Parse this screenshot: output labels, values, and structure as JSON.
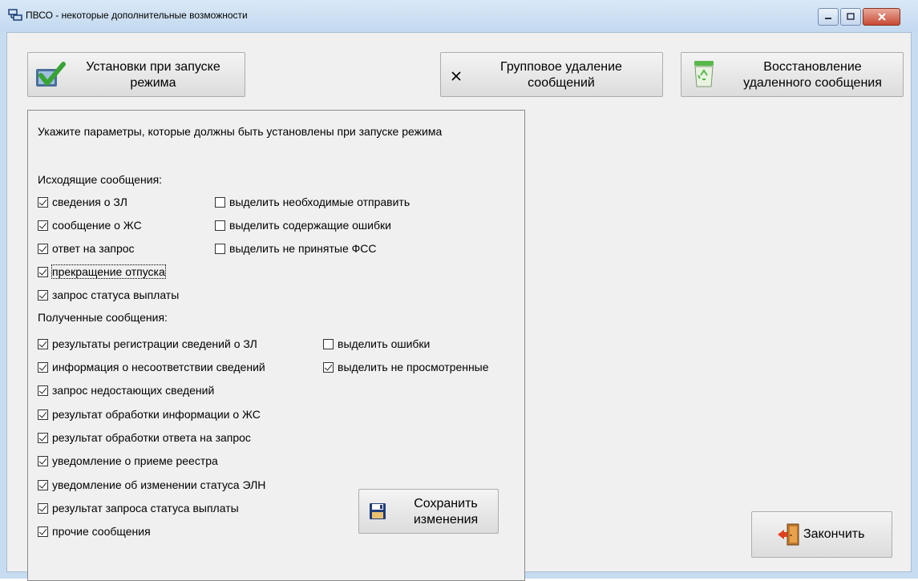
{
  "window": {
    "title": "ПВСО - некоторые дополнительные возможности"
  },
  "toolbar": {
    "startup_button": "Установки при запуске режима",
    "startup_line1": "Установки при запуске",
    "startup_line2": "режима",
    "group_delete_line1": "Групповое удаление",
    "group_delete_line2": "сообщений",
    "restore_line1": "Восстановление",
    "restore_line2": "удаленного сообщения"
  },
  "panel": {
    "instruction": "Укажите параметры, которые должны быть установлены при запуске режима",
    "outgoing_header": "Исходящие сообщения:",
    "outgoing_items": [
      {
        "label": "сведения о ЗЛ",
        "checked": true
      },
      {
        "label": "сообщение о ЖС",
        "checked": true
      },
      {
        "label": "ответ на запрос",
        "checked": true
      },
      {
        "label": "прекращение отпуска",
        "checked": true
      },
      {
        "label": "запрос статуса выплаты",
        "checked": true
      }
    ],
    "outgoing_options": [
      {
        "label": "выделить необходимые отправить",
        "checked": false
      },
      {
        "label": "выделить содержащие ошибки",
        "checked": false
      },
      {
        "label": "выделить не принятые ФСС",
        "checked": false
      }
    ],
    "received_header": "Полученные сообщения:",
    "received_items": [
      {
        "label": "результаты регистрации сведений о ЗЛ",
        "checked": true
      },
      {
        "label": "информация о несоответствии сведений",
        "checked": true
      },
      {
        "label": "запрос недостающих сведений",
        "checked": true
      },
      {
        "label": "результат обработки информации о ЖС",
        "checked": true
      },
      {
        "label": "результат обработки ответа на запрос",
        "checked": true
      },
      {
        "label": "уведомление о приеме реестра",
        "checked": true
      },
      {
        "label": "уведомление об изменении статуса ЭЛН",
        "checked": true
      },
      {
        "label": "результат запроса статуса выплаты",
        "checked": true
      },
      {
        "label": "прочие сообщения",
        "checked": true
      }
    ],
    "received_options": [
      {
        "label": "выделить ошибки",
        "checked": false
      },
      {
        "label": "выделить не просмотренные",
        "checked": true
      }
    ],
    "save_line1": "Сохранить",
    "save_line2": "изменения"
  },
  "finish_button": "Закончить",
  "colors": {
    "checkmark_green": "#3aa336",
    "floppy_blue": "#1f3d7a",
    "recycle_green": "#58b84a",
    "close_red": "#c84a33"
  }
}
